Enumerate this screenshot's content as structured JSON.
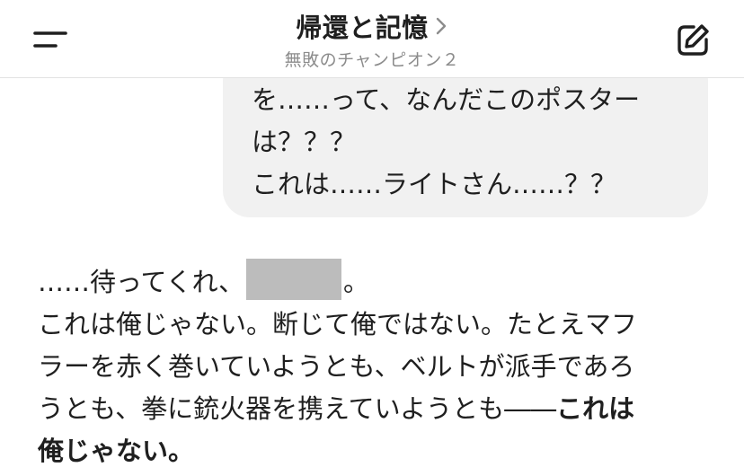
{
  "header": {
    "title": "帰還と記憶",
    "subtitle": "無敗のチャンピオン２",
    "icons": {
      "menu": "menu-icon",
      "title_chevron": "chevron-right-icon",
      "edit": "compose-icon"
    }
  },
  "chat": {
    "user_message": {
      "lines": [
        "を……って、なんだこのポスター",
        "は？？？",
        "これは……ライトさん……？？"
      ]
    },
    "reply": {
      "line1_prefix": "……待ってくれ、",
      "line1_suffix": "。",
      "line2": "これは俺じゃない。断じて俺ではない。たとえマフ",
      "line3": "ラーを赤く巻いていようとも、ベルトが派手であろ",
      "line4_normal": "うとも、拳に銃火器を携えていようとも――",
      "line4_bold": "これは",
      "line5_bold": "俺じゃない。"
    }
  },
  "colors": {
    "background": "#ffffff",
    "bubble": "#f1f1f1",
    "redaction": "#bcbcbc",
    "subtitle": "#8c8c8c",
    "text": "#1f1f1f"
  }
}
